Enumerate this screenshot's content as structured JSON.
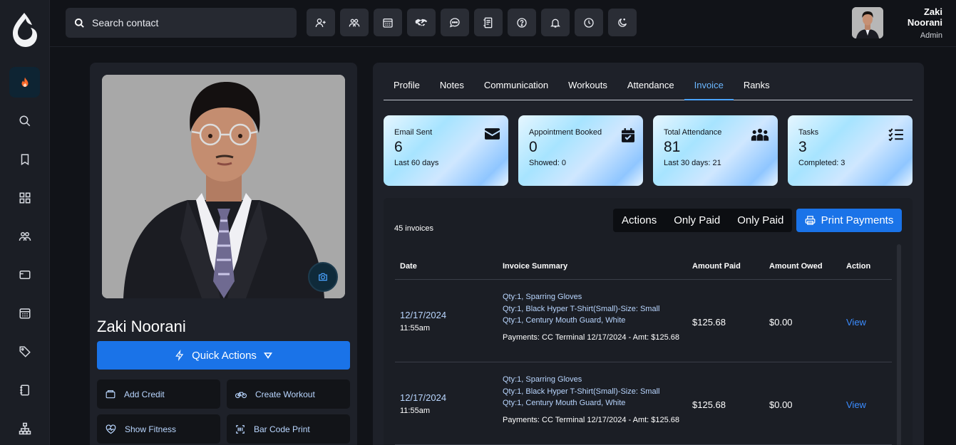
{
  "search": {
    "placeholder": "Search contact"
  },
  "user": {
    "name": "Zaki Noorani",
    "role": "Admin"
  },
  "profile": {
    "name": "Zaki Noorani",
    "quick_actions_label": "Quick Actions",
    "actions": [
      {
        "label": "Add Credit",
        "icon": "wallet-icon"
      },
      {
        "label": "Create Workout",
        "icon": "bicycle-icon"
      },
      {
        "label": "Show Fitness",
        "icon": "heart-pulse-icon"
      },
      {
        "label": "Bar Code Print",
        "icon": "barcode-icon"
      }
    ]
  },
  "tabs": [
    "Profile",
    "Notes",
    "Communication",
    "Workouts",
    "Attendance",
    "Invoice",
    "Ranks"
  ],
  "active_tab": "Invoice",
  "stats": [
    {
      "title": "Email Sent",
      "value": "6",
      "sub": "Last 60 days",
      "icon": "envelope-icon"
    },
    {
      "title": "Appointment Booked",
      "value": "0",
      "sub": "Showed: 0",
      "icon": "calendar-check-icon"
    },
    {
      "title": "Total Attendance",
      "value": "81",
      "sub": "Last 30 days: 21",
      "icon": "people-group-icon"
    },
    {
      "title": "Tasks",
      "value": "3",
      "sub": "Completed: 3",
      "icon": "checklist-icon"
    }
  ],
  "invoices": {
    "count_label": "45 invoices",
    "filters": [
      "Actions",
      "Only Paid",
      "Only Paid"
    ],
    "print_label": "Print Payments",
    "headers": {
      "date": "Date",
      "summary": "Invoice Summary",
      "paid": "Amount Paid",
      "owed": "Amount Owed",
      "action": "Action"
    },
    "rows": [
      {
        "date": "12/17/2024",
        "time": "11:55am",
        "items": [
          "Qty:1, Sparring Gloves",
          "Qty:1, Black Hyper T-Shirt(Small)-Size: Small",
          "Qty:1, Century Mouth Guard, White"
        ],
        "payment": "Payments: CC Terminal 12/17/2024 - Amt: $125.68",
        "paid": "$125.68",
        "owed": "$0.00",
        "action": "View"
      },
      {
        "date": "12/17/2024",
        "time": "11:55am",
        "items": [
          "Qty:1, Sparring Gloves",
          "Qty:1, Black Hyper T-Shirt(Small)-Size: Small",
          "Qty:1, Century Mouth Guard, White"
        ],
        "payment": "Payments: CC Terminal 12/17/2024 - Amt: $125.68",
        "paid": "$125.68",
        "owed": "$0.00",
        "action": "View"
      }
    ]
  },
  "colors": {
    "accent": "#1a73e8",
    "link": "#3b8cff",
    "active_tab": "#6bb7ff",
    "active_nav": "#ff6a2a"
  }
}
